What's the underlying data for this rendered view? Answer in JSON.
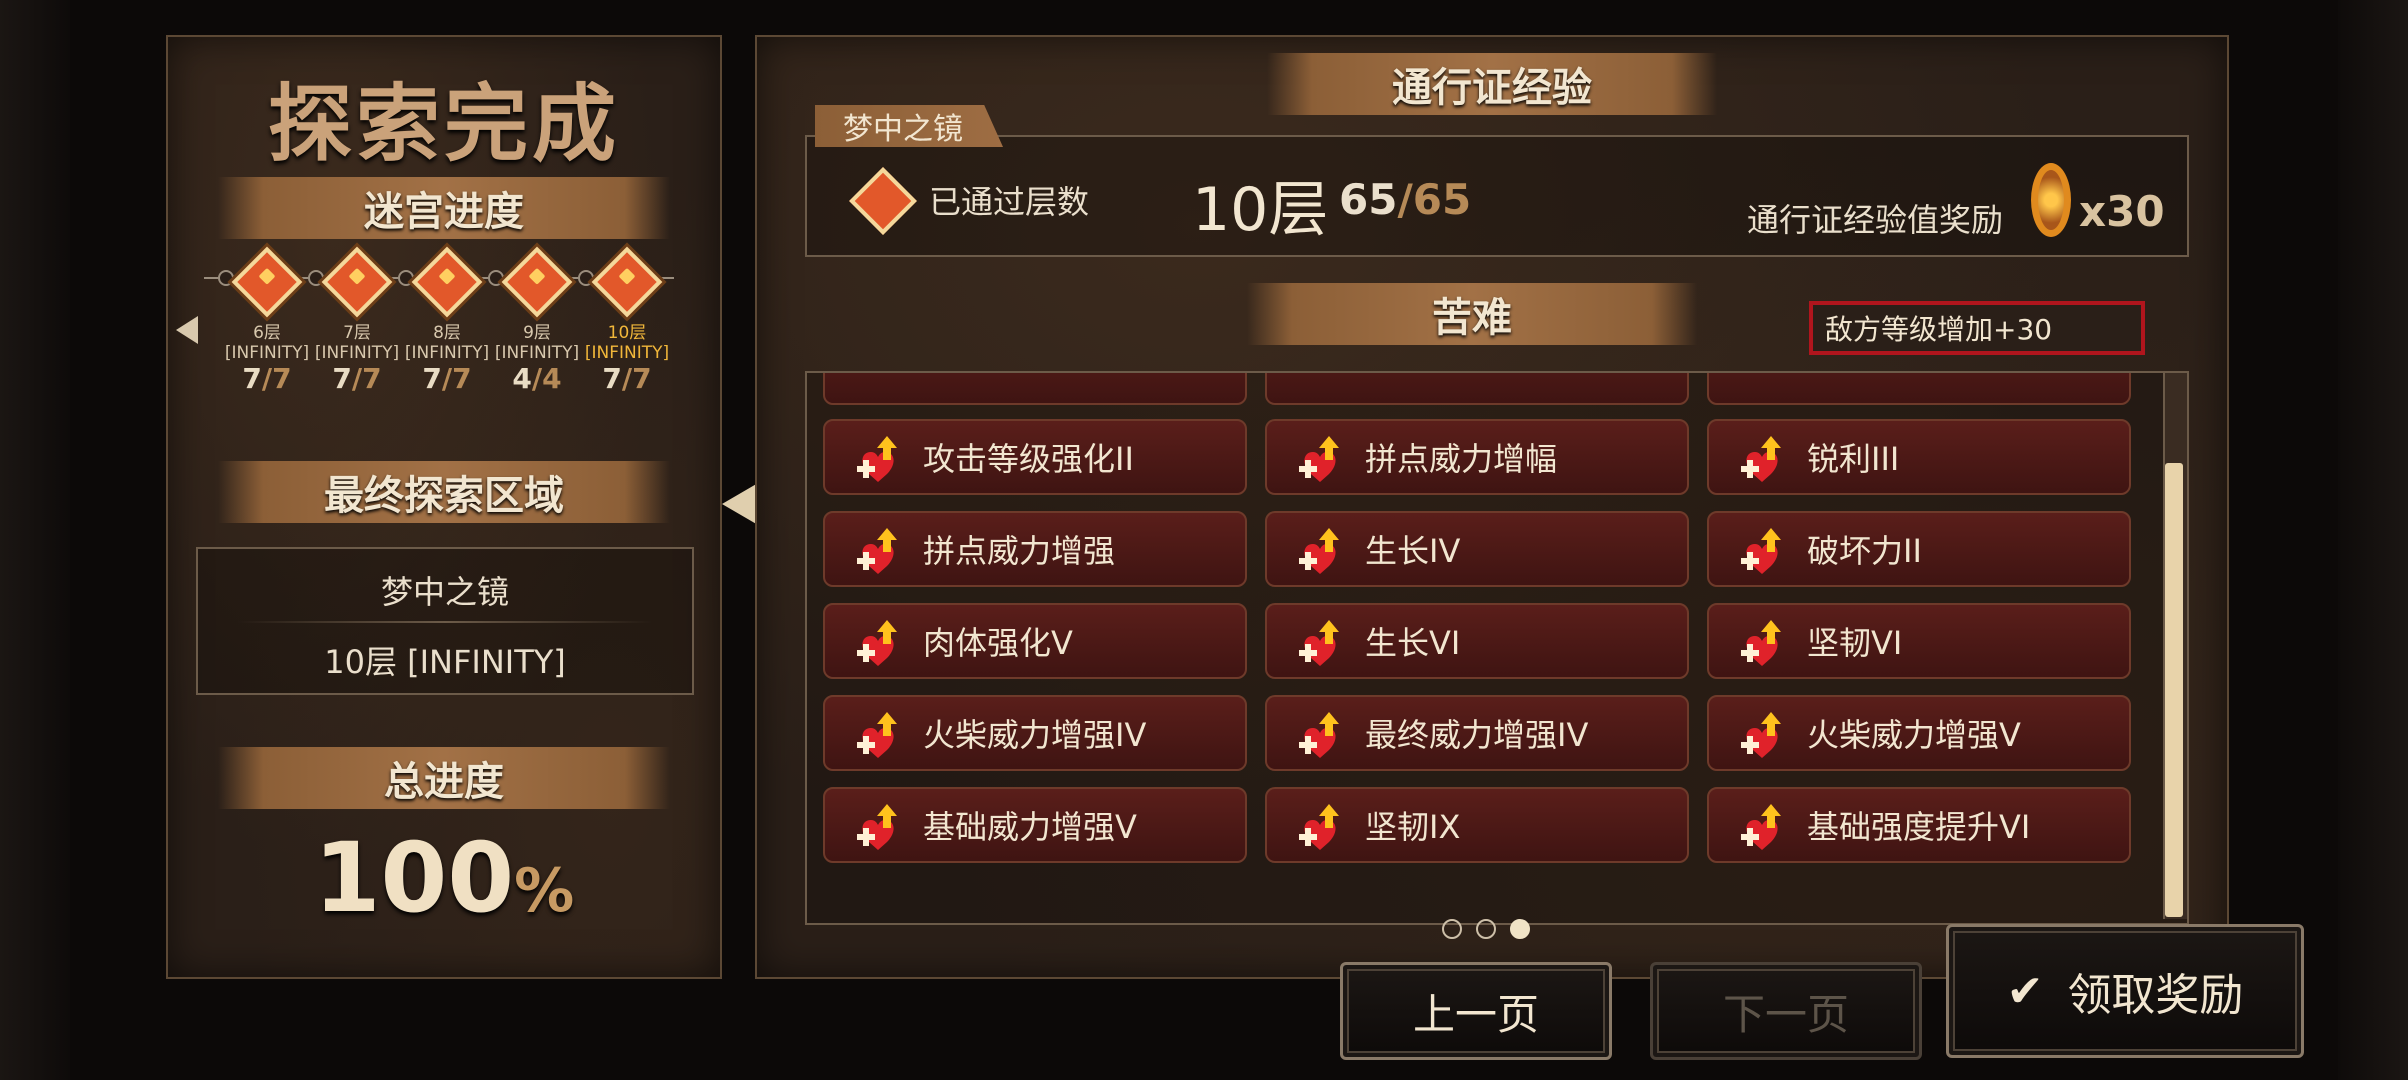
{
  "left": {
    "title": "探索完成",
    "maze_progress_label": "迷宫进度",
    "floors": [
      {
        "name": "6层",
        "tag": "[INFINITY]",
        "done": "7",
        "total": "/7"
      },
      {
        "name": "7层",
        "tag": "[INFINITY]",
        "done": "7",
        "total": "/7"
      },
      {
        "name": "8层",
        "tag": "[INFINITY]",
        "done": "7",
        "total": "/7"
      },
      {
        "name": "9层",
        "tag": "[INFINITY]",
        "done": "4",
        "total": "/4"
      },
      {
        "name": "10层",
        "tag": "[INFINITY]",
        "done": "7",
        "total": "/7"
      }
    ],
    "final_area_label": "最终探索区域",
    "final_area_name": "梦中之镜",
    "final_area_floor": "10层 [INFINITY]",
    "total_progress_label": "总进度",
    "total_progress_value": "100",
    "total_progress_unit": "%"
  },
  "right": {
    "pass_exp_label": "通行证经验",
    "stage_name": "梦中之镜",
    "passed_floors_label": "已通过层数",
    "passed_floors_value": "10层",
    "passed_count": "65",
    "passed_total": "/65",
    "reward_label": "通行证经验值奖励",
    "reward_multiplier": "x30",
    "hardship_label": "苦难",
    "enemy_level_tag": "敌方等级增加+30",
    "cards": [
      {
        "label": "攻击等级强化II",
        "icon": "sword-up-icon"
      },
      {
        "label": "拼点威力增幅",
        "icon": "heart-plus-icon"
      },
      {
        "label": "锐利III",
        "icon": "blade-heart-icon"
      },
      {
        "label": "拼点威力增强",
        "icon": "heart-plus-icon"
      },
      {
        "label": "生长IV",
        "icon": "growth-icon"
      },
      {
        "label": "破坏力II",
        "icon": "break-icon"
      },
      {
        "label": "肉体强化V",
        "icon": "sword-up-icon"
      },
      {
        "label": "生长VI",
        "icon": "growth-icon"
      },
      {
        "label": "坚韧VI",
        "icon": "tough-icon"
      },
      {
        "label": "火柴威力增强IV",
        "icon": "heart-plus-icon"
      },
      {
        "label": "最终威力增强IV",
        "icon": "heart-plus-icon"
      },
      {
        "label": "火柴威力增强V",
        "icon": "heart-plus-icon"
      },
      {
        "label": "基础威力增强V",
        "icon": "sword-up-icon"
      },
      {
        "label": "坚韧IX",
        "icon": "tough-icon"
      },
      {
        "label": "基础强度提升VI",
        "icon": "sword-up-icon"
      }
    ],
    "pages": {
      "current": 3,
      "total": 3
    }
  },
  "buttons": {
    "prev": "上一页",
    "next": "下一页",
    "claim": "领取奖励"
  },
  "colors": {
    "accent": "#f1b73a",
    "card_bg": "#4a1816",
    "highlight_border": "#b0151d"
  }
}
